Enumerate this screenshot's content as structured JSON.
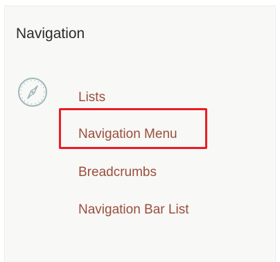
{
  "panel": {
    "title": "Navigation",
    "icon": "compass-icon"
  },
  "nav": {
    "items": [
      {
        "label": "Lists"
      },
      {
        "label": "Navigation Menu",
        "highlighted": true
      },
      {
        "label": "Breadcrumbs"
      },
      {
        "label": "Navigation Bar List"
      }
    ]
  },
  "colors": {
    "link": "#9a4e3a",
    "highlight": "#ea1c23",
    "icon": "#9fb7b8",
    "background": "#f8f8f7"
  }
}
